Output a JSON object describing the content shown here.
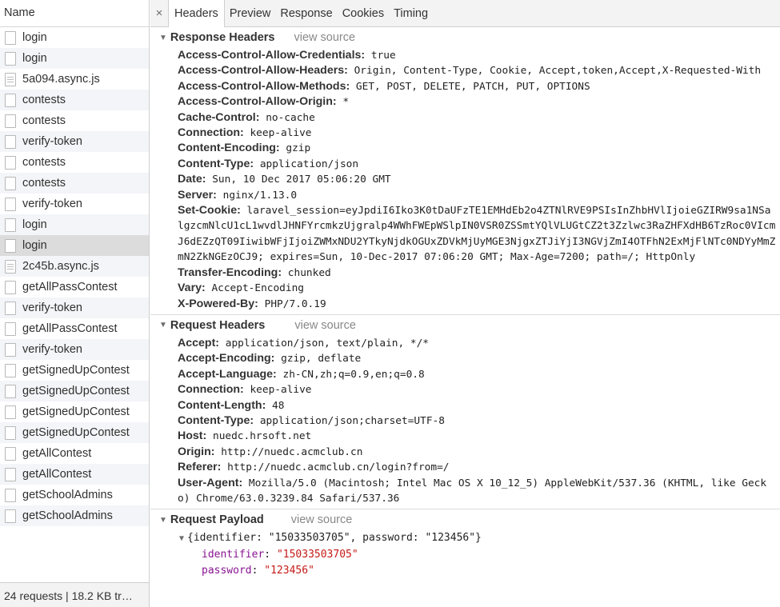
{
  "left": {
    "header": "Name",
    "requests": [
      {
        "name": "login",
        "type": "doc"
      },
      {
        "name": "login",
        "type": "doc"
      },
      {
        "name": "5a094.async.js",
        "type": "js"
      },
      {
        "name": "contests",
        "type": "doc"
      },
      {
        "name": "contests",
        "type": "doc"
      },
      {
        "name": "verify-token",
        "type": "doc"
      },
      {
        "name": "contests",
        "type": "doc"
      },
      {
        "name": "contests",
        "type": "doc"
      },
      {
        "name": "verify-token",
        "type": "doc"
      },
      {
        "name": "login",
        "type": "doc"
      },
      {
        "name": "login",
        "type": "doc",
        "selected": true
      },
      {
        "name": "2c45b.async.js",
        "type": "js"
      },
      {
        "name": "getAllPassContest",
        "type": "doc"
      },
      {
        "name": "verify-token",
        "type": "doc"
      },
      {
        "name": "getAllPassContest",
        "type": "doc"
      },
      {
        "name": "verify-token",
        "type": "doc"
      },
      {
        "name": "getSignedUpContest",
        "type": "doc"
      },
      {
        "name": "getSignedUpContest",
        "type": "doc"
      },
      {
        "name": "getSignedUpContest",
        "type": "doc"
      },
      {
        "name": "getSignedUpContest",
        "type": "doc"
      },
      {
        "name": "getAllContest",
        "type": "doc"
      },
      {
        "name": "getAllContest",
        "type": "doc"
      },
      {
        "name": "getSchoolAdmins",
        "type": "doc"
      },
      {
        "name": "getSchoolAdmins",
        "type": "doc"
      }
    ],
    "footer": "24 requests | 18.2 KB tr…"
  },
  "tabs": {
    "close": "×",
    "items": [
      "Headers",
      "Preview",
      "Response",
      "Cookies",
      "Timing"
    ],
    "active": 0
  },
  "response_headers": {
    "title": "Response Headers",
    "view_source": "view source",
    "items": [
      {
        "k": "Access-Control-Allow-Credentials:",
        "v": "true"
      },
      {
        "k": "Access-Control-Allow-Headers:",
        "v": "Origin, Content-Type, Cookie, Accept,token,Accept,X-Requested-With"
      },
      {
        "k": "Access-Control-Allow-Methods:",
        "v": "GET, POST, DELETE, PATCH, PUT, OPTIONS"
      },
      {
        "k": "Access-Control-Allow-Origin:",
        "v": "*"
      },
      {
        "k": "Cache-Control:",
        "v": "no-cache"
      },
      {
        "k": "Connection:",
        "v": "keep-alive"
      },
      {
        "k": "Content-Encoding:",
        "v": "gzip"
      },
      {
        "k": "Content-Type:",
        "v": "application/json"
      },
      {
        "k": "Date:",
        "v": "Sun, 10 Dec 2017 05:06:20 GMT"
      },
      {
        "k": "Server:",
        "v": "nginx/1.13.0"
      },
      {
        "k": "Set-Cookie:",
        "v": "laravel_session=eyJpdiI6Iko3K0tDaUFzTE1EMHdEb2o4ZTNlRVE9PSIsInZhbHVlIjoieGZIRW9sa1NSalgzcmNlcU1cL1wvdlJHNFYrcmkzUjgralp4WWhFWEpWSlpIN0VSR0ZSSmtYQlVLUGtCZ2t3Zzlwc3RaZHFXdHB6TzRoc0VIcmJ6dEZzQT09IiwibWFjIjoiZWMxNDU2YTkyNjdkOGUxZDVkMjUyMGE3NjgxZTJiYjI3NGVjZmI4OTFhN2ExMjFlNTc0NDYyMmZmN2ZkNGEzOCJ9; expires=Sun, 10-Dec-2017 07:06:20 GMT; Max-Age=7200; path=/; HttpOnly"
      },
      {
        "k": "Transfer-Encoding:",
        "v": "chunked"
      },
      {
        "k": "Vary:",
        "v": "Accept-Encoding"
      },
      {
        "k": "X-Powered-By:",
        "v": "PHP/7.0.19"
      }
    ]
  },
  "request_headers": {
    "title": "Request Headers",
    "view_source": "view source",
    "items": [
      {
        "k": "Accept:",
        "v": "application/json, text/plain, */*"
      },
      {
        "k": "Accept-Encoding:",
        "v": "gzip, deflate"
      },
      {
        "k": "Accept-Language:",
        "v": "zh-CN,zh;q=0.9,en;q=0.8"
      },
      {
        "k": "Connection:",
        "v": "keep-alive"
      },
      {
        "k": "Content-Length:",
        "v": "48"
      },
      {
        "k": "Content-Type:",
        "v": "application/json;charset=UTF-8"
      },
      {
        "k": "Host:",
        "v": "nuedc.hrsoft.net"
      },
      {
        "k": "Origin:",
        "v": "http://nuedc.acmclub.cn"
      },
      {
        "k": "Referer:",
        "v": "http://nuedc.acmclub.cn/login?from=/"
      },
      {
        "k": "User-Agent:",
        "v": "Mozilla/5.0 (Macintosh; Intel Mac OS X 10_12_5) AppleWebKit/537.36 (KHTML, like Gecko) Chrome/63.0.3239.84 Safari/537.36"
      }
    ]
  },
  "payload": {
    "title": "Request Payload",
    "view_source": "view source",
    "summary": "{identifier: \"15033503705\", password: \"123456\"}",
    "props": [
      {
        "k": "identifier",
        "v": "\"15033503705\""
      },
      {
        "k": "password",
        "v": "\"123456\""
      }
    ]
  }
}
